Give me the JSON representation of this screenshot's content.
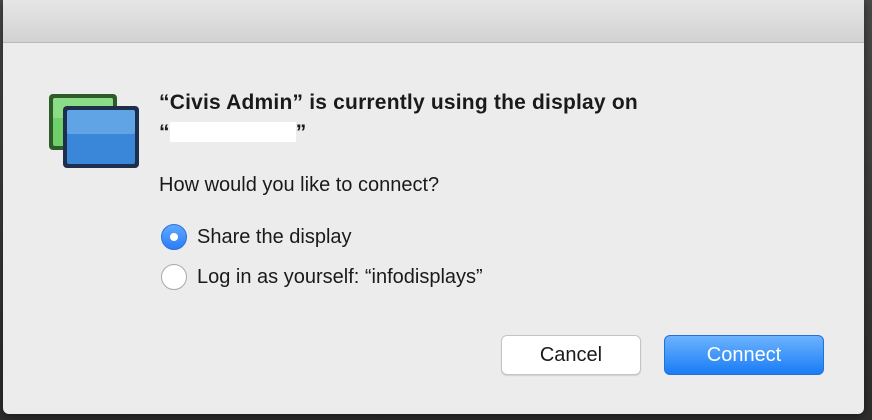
{
  "dialog": {
    "title_line1": "“Civis Admin” is currently using the display on",
    "title_line2_open": "“",
    "title_line2_close": "”",
    "question": "How would you like to connect?",
    "options": [
      {
        "label": "Share the display",
        "selected": true
      },
      {
        "label": "Log in as yourself: “infodisplays”",
        "selected": false
      }
    ],
    "buttons": {
      "cancel": "Cancel",
      "connect": "Connect"
    },
    "icon": "screen-sharing-icon"
  },
  "colors": {
    "accent": "#1a7cf5",
    "dialog_bg": "#ececec"
  }
}
